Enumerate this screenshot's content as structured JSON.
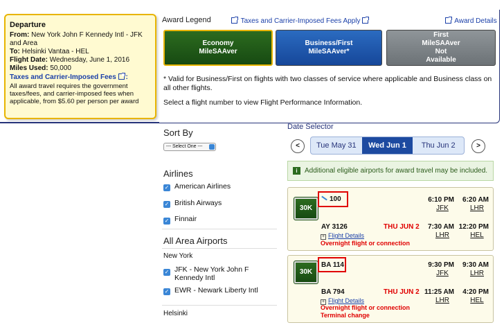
{
  "departure": {
    "heading": "Departure",
    "from_label": "From:",
    "from_value": "New York John F Kennedy Intl - JFK and Area",
    "to_label": "To:",
    "to_value": "Helsinki Vantaa - HEL",
    "flight_date_label": "Flight Date:",
    "flight_date_value": "Wednesday, June 1, 2016",
    "miles_used_label": "Miles Used:",
    "miles_used_value": "50,000",
    "fees_link": "Taxes and Carrier-Imposed Fees",
    "fees_colon": ":",
    "note": "All award travel requires the government taxes/fees, and carrier-imposed fees when applicable, from $5.60 per person per award"
  },
  "legend": {
    "title": "Award Legend",
    "fees_link": "Taxes and Carrier-Imposed Fees Apply",
    "award_details_link": "Award Details",
    "economy": {
      "line1": "Economy",
      "line2": "MileSAAver"
    },
    "business": {
      "line1": "Business/First",
      "line2": "MileSAAver*"
    },
    "first": {
      "line1": "First",
      "line2": "MileSAAver",
      "line3": "Not",
      "line4": "Available"
    }
  },
  "info": {
    "valid_note": "* Valid for Business/First on flights with two classes of service where applicable and Business class on all other flights.",
    "select_note": "Select a flight number to view Flight Performance Information."
  },
  "sidebar": {
    "sort_by": "Sort By",
    "select_value": "--- Select One ---",
    "airlines_heading": "Airlines",
    "airlines": [
      "American Airlines",
      "British Airways",
      "Finnair"
    ],
    "airports_heading": "All Area Airports",
    "city1": "New York",
    "airports": [
      "JFK - New York John F Kennedy Intl",
      "EWR - Newark Liberty Intl"
    ],
    "city2": "Helsinki"
  },
  "date_selector": {
    "label": "Date Selector",
    "prev": "Tue May 31",
    "current": "Wed Jun 1",
    "next": "Thu Jun 2",
    "nav_prev": "<",
    "nav_next": ">"
  },
  "notice": {
    "icon": "i",
    "text": "Additional eligible airports for award travel may be included."
  },
  "flights": [
    {
      "miles": "30K",
      "seg1": {
        "flight": "100",
        "dep_time": "6:10 PM",
        "arr_time": "6:20 AM",
        "dep_ap": "JFK",
        "arr_ap": "LHR"
      },
      "seg2": {
        "flight": "AY 3126",
        "date": "THU JUN 2",
        "dep_time": "7:30 AM",
        "arr_time": "12:20 PM",
        "dep_ap": "LHR",
        "arr_ap": "HEL"
      },
      "details": "Flight Details",
      "warn1": "Overnight flight or connection"
    },
    {
      "miles": "30K",
      "seg1": {
        "flight": "BA 114",
        "dep_time": "9:30 PM",
        "arr_time": "9:30 AM",
        "dep_ap": "JFK",
        "arr_ap": "LHR"
      },
      "seg2": {
        "flight": "BA 794",
        "date": "THU JUN 2",
        "dep_time": "11:25 AM",
        "arr_time": "4:20 PM",
        "dep_ap": "LHR",
        "arr_ap": "HEL"
      },
      "details": "Flight Details",
      "warn1": "Overnight flight or connection",
      "warn2": "Terminal change"
    }
  ],
  "colors": {
    "navy": "#26337a",
    "gold": "#e8b400",
    "green": "#2c6b1f",
    "blue": "#1d4aa0",
    "gray": "#7a8084",
    "red": "#e00000"
  }
}
